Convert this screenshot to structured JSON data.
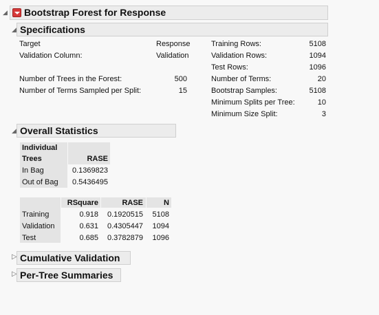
{
  "report": {
    "title": "Bootstrap Forest for Response"
  },
  "specifications": {
    "title": "Specifications",
    "left": [
      {
        "label": "Target",
        "value": "Response"
      },
      {
        "label": "Validation Column:",
        "value": "Validation"
      },
      {
        "label": "Number of Trees in the Forest:",
        "value": "500"
      },
      {
        "label": "Number of Terms Sampled per Split:",
        "value": "15"
      }
    ],
    "right": [
      {
        "label": "Training Rows:",
        "value": "5108"
      },
      {
        "label": "Validation Rows:",
        "value": "1094"
      },
      {
        "label": "Test Rows:",
        "value": "1096"
      },
      {
        "label": "Number of Terms:",
        "value": "20"
      },
      {
        "label": "Bootstrap Samples:",
        "value": "5108"
      },
      {
        "label": "Minimum Splits per Tree:",
        "value": "10"
      },
      {
        "label": "Minimum Size Split:",
        "value": "3"
      }
    ]
  },
  "overall": {
    "title": "Overall Statistics",
    "individual": {
      "header1": "Individual",
      "header2": "Trees",
      "col": "RASE",
      "rows": [
        {
          "label": "In Bag",
          "rase": "0.1369823"
        },
        {
          "label": "Out of Bag",
          "rase": "0.5436495"
        }
      ]
    },
    "summary": {
      "columns": [
        "RSquare",
        "RASE",
        "N"
      ],
      "rows": [
        {
          "label": "Training",
          "rsquare": "0.918",
          "rase": "0.1920515",
          "n": "5108"
        },
        {
          "label": "Validation",
          "rsquare": "0.631",
          "rase": "0.4305447",
          "n": "1094"
        },
        {
          "label": "Test",
          "rsquare": "0.685",
          "rase": "0.3782879",
          "n": "1096"
        }
      ]
    }
  },
  "collapsed": {
    "cumulative": "Cumulative Validation",
    "pertree": "Per-Tree Summaries"
  }
}
